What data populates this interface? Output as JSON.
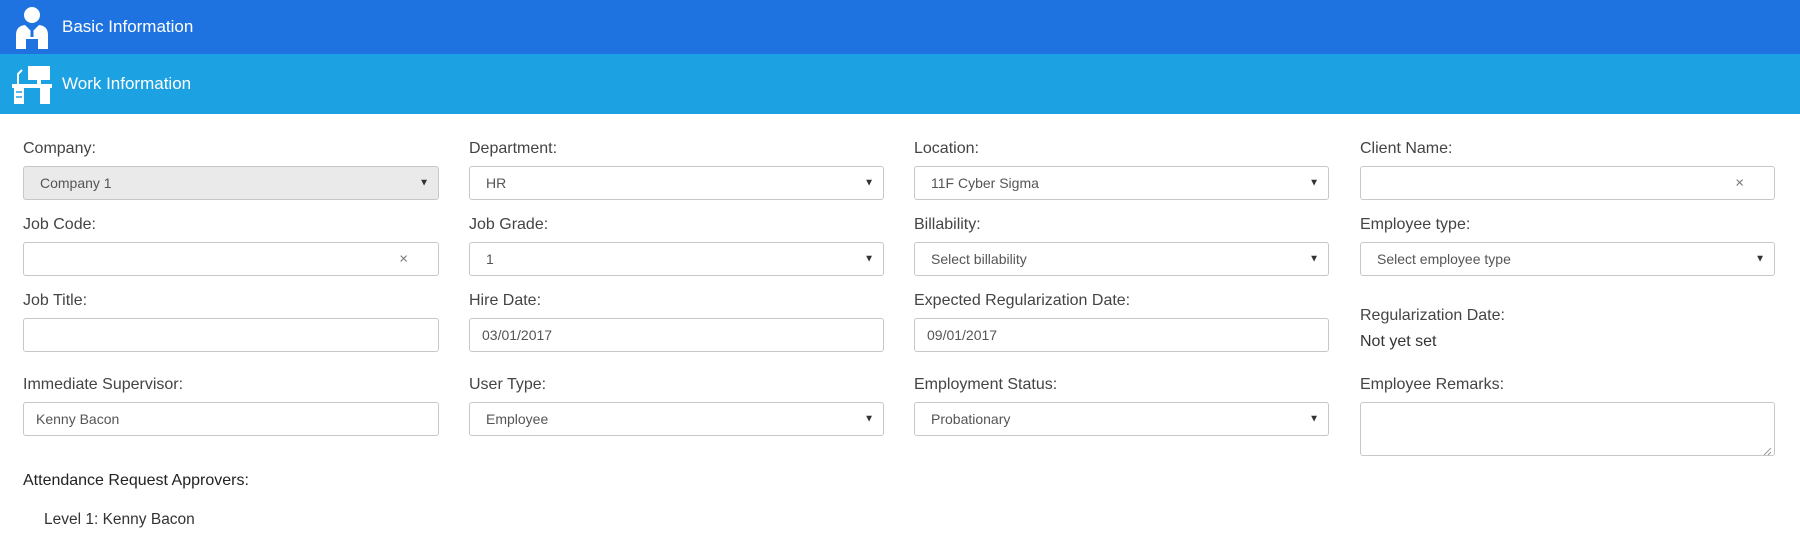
{
  "sections": {
    "basic": {
      "title": "Basic Information",
      "icon": "person-icon"
    },
    "work": {
      "title": "Work Information",
      "icon": "desk-icon"
    }
  },
  "fields": {
    "company": {
      "label": "Company:",
      "value": "Company 1"
    },
    "department": {
      "label": "Department:",
      "value": "HR"
    },
    "location": {
      "label": "Location:",
      "value": "11F Cyber Sigma"
    },
    "client_name": {
      "label": "Client Name:",
      "value": ""
    },
    "job_code": {
      "label": "Job Code:",
      "value": ""
    },
    "job_grade": {
      "label": "Job Grade:",
      "value": "1"
    },
    "billability": {
      "label": "Billability:",
      "value": "Select billability"
    },
    "employee_type": {
      "label": "Employee type:",
      "value": "Select employee type"
    },
    "job_title": {
      "label": "Job Title:",
      "value": ""
    },
    "hire_date": {
      "label": "Hire Date:",
      "value": "03/01/2017"
    },
    "expected_regularization_date": {
      "label": "Expected Regularization Date:",
      "value": "09/01/2017"
    },
    "regularization_date": {
      "label": "Regularization Date:",
      "value": "Not yet set"
    },
    "immediate_supervisor": {
      "label": "Immediate Supervisor:",
      "value": "Kenny Bacon"
    },
    "user_type": {
      "label": "User Type:",
      "value": "Employee"
    },
    "employment_status": {
      "label": "Employment Status:",
      "value": "Probationary"
    },
    "employee_remarks": {
      "label": "Employee Remarks:",
      "value": ""
    }
  },
  "approvers": {
    "heading": "Attendance Request Approvers:",
    "levels": [
      "Level 1: Kenny Bacon"
    ]
  },
  "glyphs": {
    "dropdown_arrow": "▼",
    "clear": "×"
  },
  "colors": {
    "basic_bar": "#1e73e0",
    "work_bar": "#1ca1e2"
  }
}
